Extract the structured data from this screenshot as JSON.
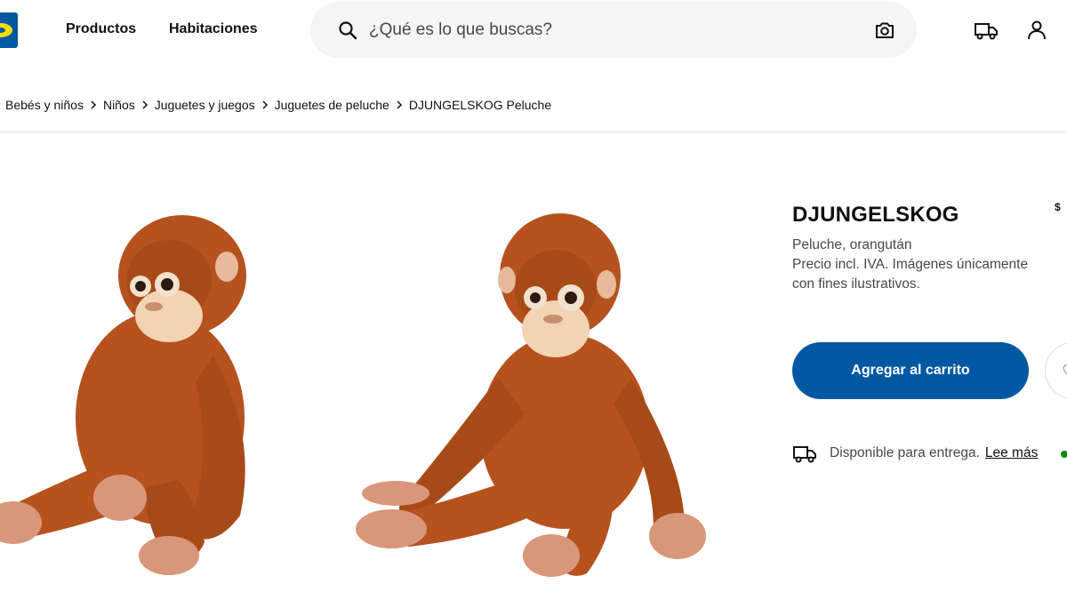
{
  "header": {
    "nav": [
      "Productos",
      "Habitaciones"
    ],
    "search_placeholder": "¿Qué es lo que buscas?"
  },
  "breadcrumb": [
    "Bebés y niños",
    "Niños",
    "Juguetes y juegos",
    "Juguetes de peluche",
    "DJUNGELSKOG Peluche"
  ],
  "product": {
    "name": "DJUNGELSKOG",
    "price_prefix": "$",
    "desc_line1": "Peluche, orangután",
    "desc_line2": "Precio incl. IVA. Imágenes únicamente",
    "desc_line3": "con fines ilustrativos.",
    "add_to_cart": "Agregar al carrito",
    "delivery_text": "Disponible para entrega.",
    "delivery_link": "Lee más"
  },
  "colors": {
    "brand_blue": "#0058a3",
    "brand_yellow": "#ffdb00",
    "fur": "#b5521e",
    "available_green": "#0a8a00"
  }
}
